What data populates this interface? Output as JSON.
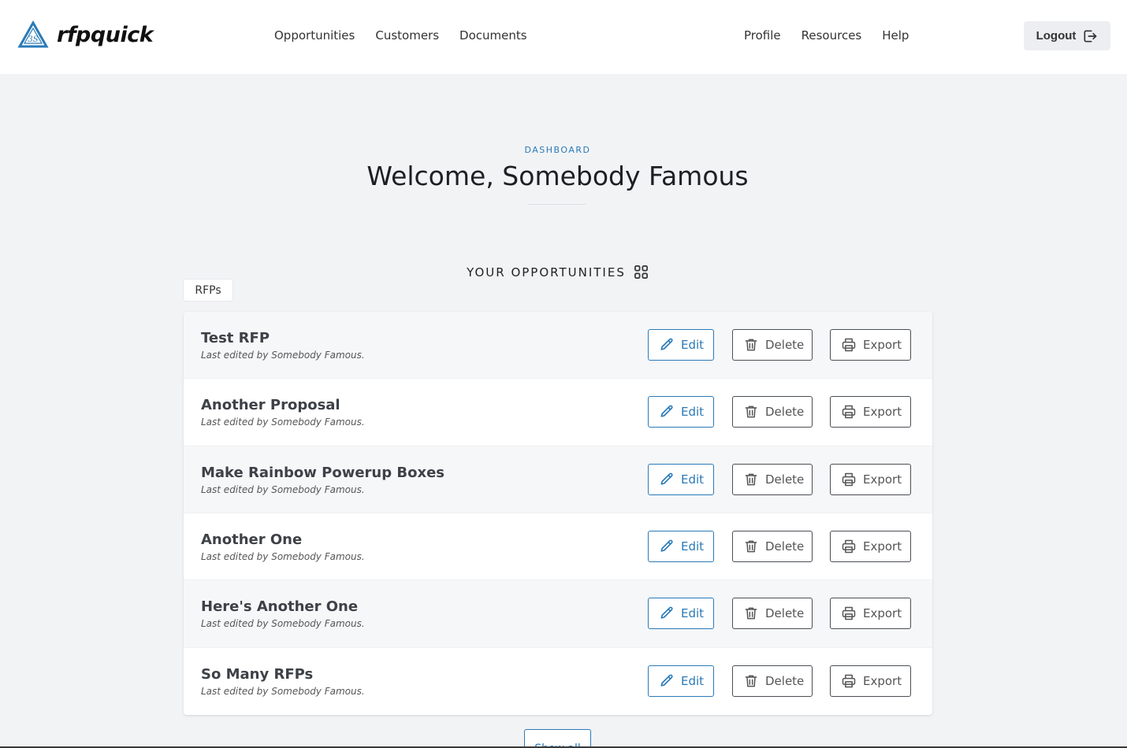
{
  "header": {
    "brand": "rfpquick",
    "logo_initials": "3S",
    "nav_left": [
      "Opportunities",
      "Customers",
      "Documents"
    ],
    "nav_right": [
      "Profile",
      "Resources",
      "Help"
    ],
    "logout_label": "Logout"
  },
  "hero": {
    "eyebrow": "DASHBOARD",
    "title": "Welcome, Somebody Famous"
  },
  "section": {
    "title": "YOUR OPPORTUNITIES",
    "tab": "RFPs"
  },
  "buttons": {
    "edit": "Edit",
    "delete": "Delete",
    "export": "Export",
    "show_all": "Show all"
  },
  "opportunities": [
    {
      "title": "Test RFP",
      "subtitle": "Last edited by Somebody Famous."
    },
    {
      "title": "Another Proposal",
      "subtitle": "Last edited by Somebody Famous."
    },
    {
      "title": "Make Rainbow Powerup Boxes",
      "subtitle": "Last edited by Somebody Famous."
    },
    {
      "title": "Another One",
      "subtitle": "Last edited by Somebody Famous."
    },
    {
      "title": "Here's Another One",
      "subtitle": "Last edited by Somebody Famous."
    },
    {
      "title": "So Many RFPs",
      "subtitle": "Last edited by Somebody Famous."
    }
  ],
  "colors": {
    "accent": "#2a7ab8",
    "page_bg": "#f2f3f5",
    "header_bg": "#ffffff"
  },
  "icons": {
    "logo": "triangle-logo-icon",
    "logout": "logout-icon",
    "grid": "grid-icon",
    "edit": "pencil-icon",
    "delete": "trash-icon",
    "export": "printer-icon"
  }
}
